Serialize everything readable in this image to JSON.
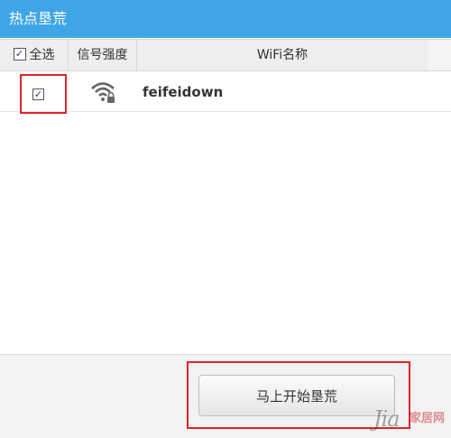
{
  "window": {
    "title": "热点垦荒"
  },
  "table": {
    "headers": {
      "select_all": "全选",
      "signal": "信号强度",
      "name": "WiFi名称"
    },
    "select_all_checked": true,
    "rows": [
      {
        "checked": true,
        "signal_icon": "wifi-locked-icon",
        "name": "feifeidown"
      }
    ]
  },
  "footer": {
    "start_button": "马上开始垦荒"
  },
  "watermark": {
    "text": "Jia",
    "sub": "家居网"
  },
  "colors": {
    "titlebar": "#3ea6e6",
    "highlight": "#e0242c"
  }
}
